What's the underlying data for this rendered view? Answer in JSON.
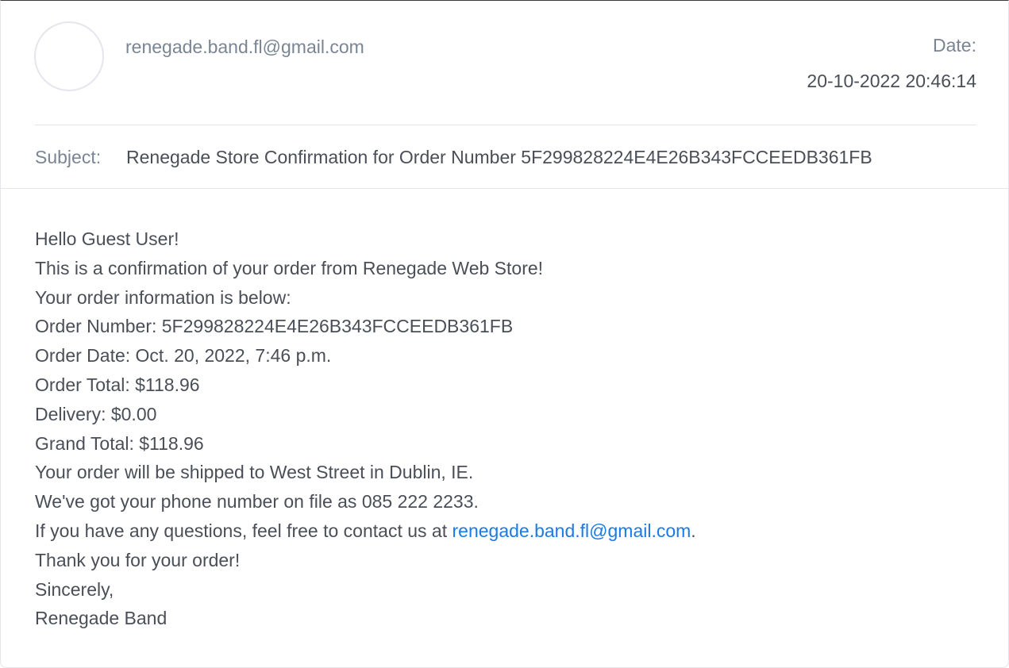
{
  "header": {
    "sender_email": "renegade.band.fl@gmail.com",
    "date_label": "Date:",
    "date_value": "20-10-2022 20:46:14",
    "subject_label": "Subject:",
    "subject_value": "Renegade Store Confirmation for Order Number 5F299828224E4E26B343FCCEEDB361FB"
  },
  "body": {
    "greeting": "Hello Guest User!",
    "intro": "This is a confirmation of your order from Renegade Web Store!",
    "info_heading": "Your order information is below:",
    "order_number": "Order Number: 5F299828224E4E26B343FCCEEDB361FB",
    "order_date": "Order Date: Oct. 20, 2022, 7:46 p.m.",
    "order_total": "Order Total: $118.96",
    "delivery": "Delivery: $0.00",
    "grand_total": "Grand Total: $118.96",
    "shipping": "Your order will be shipped to West Street in Dublin, IE.",
    "phone": "We've got your phone number on file as 085 222 2233.",
    "contact_prefix": "If you have any questions, feel free to contact us at ",
    "contact_email": "renegade.band.fl@gmail.com",
    "contact_suffix": ".",
    "thanks": "Thank you for your order!",
    "signoff": "Sincerely,",
    "signature": "Renegade Band"
  },
  "colors": {
    "label_gray": "#7a8594",
    "text_dark": "#4a4f57",
    "link_blue": "#1a7ae6"
  }
}
